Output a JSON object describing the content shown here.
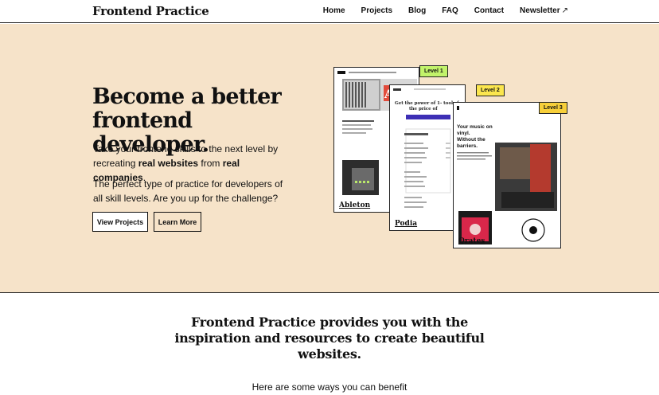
{
  "nav": {
    "brand": "Frontend Practice",
    "links": [
      "Home",
      "Projects",
      "Blog",
      "FAQ",
      "Contact",
      "Newsletter"
    ],
    "external_arrow": "↗"
  },
  "hero": {
    "title": "Become a better frontend developer.",
    "p1_a": "Take your frontend skills to the next level by recreating ",
    "p1_b": "real websites",
    "p1_c": " from ",
    "p1_d": "real companies",
    "p1_e": ".",
    "p2": "The perfect type of practice for developers of all skill levels. Are you up for the challenge?",
    "btn_view": "View Projects",
    "btn_learn": "Learn More"
  },
  "cards": [
    {
      "caption": "Ableton",
      "level": "Level 1"
    },
    {
      "caption": "Podia",
      "level": "Level 2",
      "headline": "Get the power of 1- tools for the price of"
    },
    {
      "caption": "Qrates",
      "level": "Level 3",
      "headline": "Your music on vinyl. Without the barriers."
    }
  ],
  "colors": {
    "hero_bg": "#f6e3c9",
    "level1": "#c2f36b",
    "level2": "#fbe64e",
    "level3": "#f7cf3a"
  },
  "mission": "Frontend Practice provides you with the inspiration and resources to create beautiful websites.",
  "benefit": "Here are some ways you can benefit"
}
